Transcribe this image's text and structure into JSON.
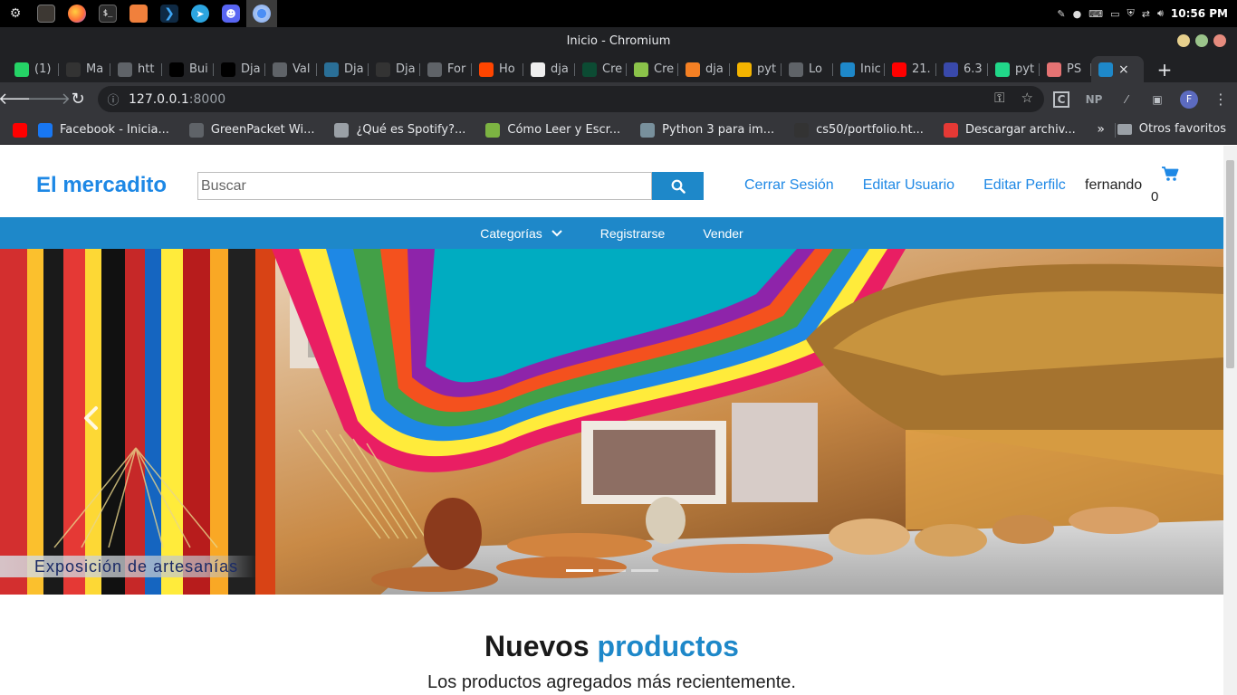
{
  "os": {
    "clock": "10:56 PM",
    "volume_icon": "volume-icon",
    "apps": [
      "files-icon",
      "firefox-icon",
      "terminal-icon",
      "folder-icon",
      "vscode-icon",
      "telegram-icon",
      "discord-icon",
      "chromium-icon"
    ]
  },
  "window": {
    "title": "Inicio - Chromium"
  },
  "tabs": [
    {
      "label": "(1)",
      "icon": "whatsapp-icon",
      "color": "#25d366"
    },
    {
      "label": "Ma",
      "icon": "codepen-icon",
      "color": "#333333"
    },
    {
      "label": "htt",
      "icon": "globe-icon",
      "color": "#5f6368"
    },
    {
      "label": "Bui",
      "icon": "dev-icon",
      "color": "#000000"
    },
    {
      "label": "Dja",
      "icon": "medium-icon",
      "color": "#000000"
    },
    {
      "label": "Val",
      "icon": "table-icon",
      "color": "#5f6368"
    },
    {
      "label": "Dja",
      "icon": "avatar-icon",
      "color": "#2a6f97"
    },
    {
      "label": "Dja",
      "icon": "person-icon",
      "color": "#333333"
    },
    {
      "label": "For",
      "icon": "book-icon",
      "color": "#5f6368"
    },
    {
      "label": "Ho",
      "icon": "reddit-icon",
      "color": "#ff4500"
    },
    {
      "label": "dja",
      "icon": "cube-icon",
      "color": "#eeeeee"
    },
    {
      "label": "Cre",
      "icon": "django-icon",
      "color": "#0c4b33"
    },
    {
      "label": "Cre",
      "icon": "diamond-icon",
      "color": "#8bc34a"
    },
    {
      "label": "dja",
      "icon": "stackoverflow-icon",
      "color": "#f48024"
    },
    {
      "label": "pyt",
      "icon": "notes-icon",
      "color": "#f4b400"
    },
    {
      "label": "Lo",
      "icon": "table-icon",
      "color": "#5f6368"
    },
    {
      "label": "Inic",
      "icon": "em-icon",
      "color": "#1e88c9"
    },
    {
      "label": "21.",
      "icon": "youtube-icon",
      "color": "#ff0000"
    },
    {
      "label": "6.3",
      "icon": "eye-icon",
      "color": "#3949ab"
    },
    {
      "label": "pyt",
      "icon": "pycharm-icon",
      "color": "#21d789"
    },
    {
      "label": "PS",
      "icon": "page-icon",
      "color": "#e57373"
    }
  ],
  "active_tab": {
    "icon": "em-icon",
    "close": "×"
  },
  "newtab_label": "+",
  "address": {
    "host": "127.0.0.1",
    "port": ":8000"
  },
  "bookmarks": [
    {
      "label": "",
      "icon": "youtube-icon",
      "color": "#ff0000"
    },
    {
      "label": "Facebook - Inicia...",
      "icon": "facebook-icon",
      "color": "#1877f2"
    },
    {
      "label": "GreenPacket Wi...",
      "icon": "globe-icon",
      "color": "#5f6368"
    },
    {
      "label": "¿Qué es Spotify?...",
      "icon": "spotify-icon",
      "color": "#9aa0a6"
    },
    {
      "label": "Cómo Leer y Escr...",
      "icon": "leaf-icon",
      "color": "#7cb342"
    },
    {
      "label": "Python 3 para im...",
      "icon": "star-icon",
      "color": "#78909c"
    },
    {
      "label": "cs50/portfolio.ht...",
      "icon": "github-icon",
      "color": "#333333"
    },
    {
      "label": "Descargar archiv...",
      "icon": "heart-icon",
      "color": "#e53935"
    }
  ],
  "bookmarks_more": "»",
  "bookmarks_other": "Otros favoritos",
  "site": {
    "brand": "El mercadito",
    "search_placeholder": "Buscar",
    "links": [
      "Cerrar Sesión",
      "Editar Usuario",
      "Editar Perfilc"
    ],
    "username": "fernando",
    "cart_count": "0",
    "accent": "#1e88c9",
    "nav": [
      {
        "label": "Categorías",
        "has_dropdown": true
      },
      {
        "label": "Registrarse"
      },
      {
        "label": "Vender"
      }
    ],
    "carousel": {
      "caption": "Exposición de artesanías",
      "slides": 3,
      "active_slide": 1
    },
    "section": {
      "title_dark": "Nuevos",
      "title_accent": "productos",
      "subtitle": "Los productos agregados más recientemente."
    }
  }
}
